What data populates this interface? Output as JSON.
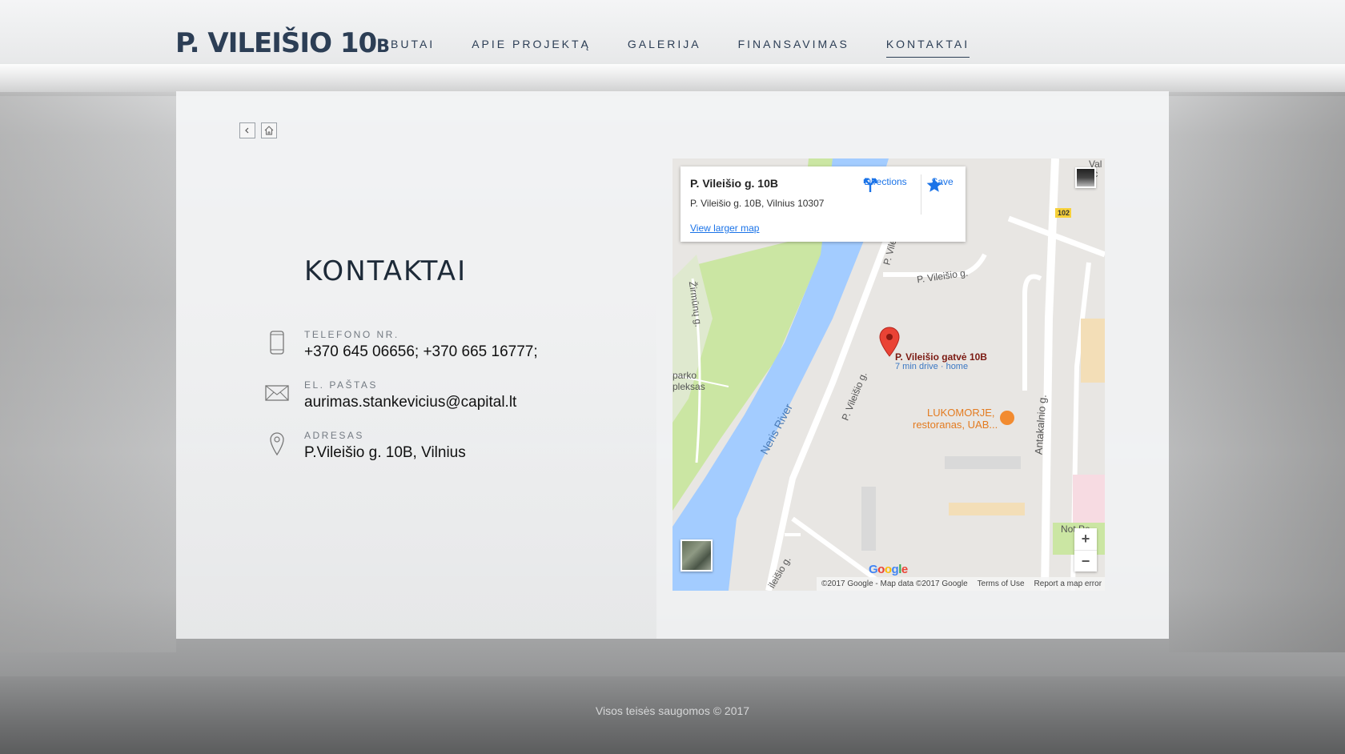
{
  "brand": {
    "logo_main": "P. VILEIŠIO 10",
    "logo_suffix": "B"
  },
  "nav": {
    "items": [
      "BUTAI",
      "APIE PROJEKTĄ",
      "GALERIJA",
      "FINANSAVIMAS",
      "KONTAKTAI"
    ],
    "active": "KONTAKTAI"
  },
  "page": {
    "title": "KONTAKTAI",
    "icons": {
      "back": "chevron-left-icon",
      "home": "home-icon"
    }
  },
  "contacts": {
    "phone": {
      "label": "TELEFONO NR.",
      "value": "+370 645 06656; +370 665 16777;",
      "icon": "phone-icon"
    },
    "email": {
      "label": "EL. PAŠTAS",
      "value": "aurimas.stankevicius@capital.lt",
      "icon": "envelope-icon"
    },
    "address": {
      "label": "ADRESAS",
      "value": "P.Vileišio g. 10B, Vilnius",
      "icon": "location-pin-icon"
    }
  },
  "map": {
    "infobox": {
      "title": "P. Vileišio g. 10B",
      "address": "P. Vileišio g. 10B, Vilnius 10307",
      "larger_map": "View larger map",
      "directions": "Directions",
      "save": "Save"
    },
    "labels": {
      "marker_title": "P. Vileišio gatvė 10B",
      "marker_sub": "7 min drive · home",
      "restaurant": "LUKOMORJE,",
      "restaurant2": "restoranas, UAB...",
      "river": "Neris River",
      "street1": "P. Vileišio g.",
      "street2": "P. Vileišio g.",
      "street3": "P. Vile",
      "street4": "Antakalnio g.",
      "street5": "Žirmūnų g.",
      "street6": "ileišio g.",
      "park1": "parko",
      "park2": "pleksas",
      "road_badge": "102",
      "top_right": "Val",
      "top_right2": "tc",
      "bottom_right": "Not Pe",
      "google": "Google"
    },
    "attribution": {
      "copyright": "©2017 Google - Map data ©2017 Google",
      "terms": "Terms of Use",
      "report": "Report a map error"
    },
    "zoom": {
      "in": "+",
      "out": "−"
    },
    "colors": {
      "water": "#a3ccff",
      "park": "#cbe6a3",
      "land": "#e8e6e3",
      "road": "#ffffff",
      "marker": "#ea4335"
    }
  },
  "footer": {
    "text": "Visos teisės saugomos © 2017"
  }
}
